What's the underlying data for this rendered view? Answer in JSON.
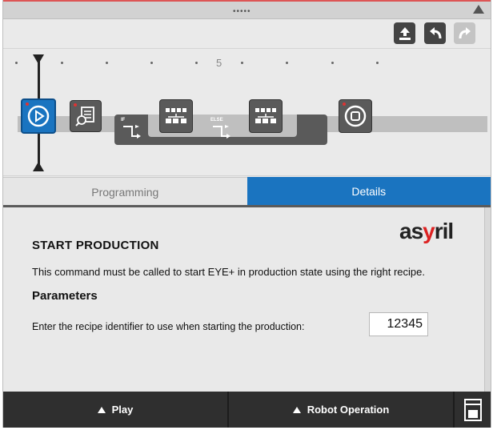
{
  "handle": {
    "dots": "•••••"
  },
  "timeline": {
    "tick_label": "5"
  },
  "blocks": {
    "if_label": "IF",
    "else_label": "ELSE"
  },
  "tabs": [
    {
      "label": "Programming",
      "active": false
    },
    {
      "label": "Details",
      "active": true
    }
  ],
  "details": {
    "logo_a": "as",
    "logo_y": "y",
    "logo_b": "ril",
    "title": "START PRODUCTION",
    "description": "This command must be called to start EYE+ in production state using the right recipe.",
    "parameters_heading": "Parameters",
    "recipe_prompt": "Enter the recipe identifier to use when starting the production:",
    "recipe_value": "12345"
  },
  "bottom_bar": {
    "play_label": "Play",
    "robot_label": "Robot Operation"
  },
  "colors": {
    "accent": "#1a74c0",
    "block": "#5a5a5a",
    "bottom_bar": "#2f2f2f"
  }
}
